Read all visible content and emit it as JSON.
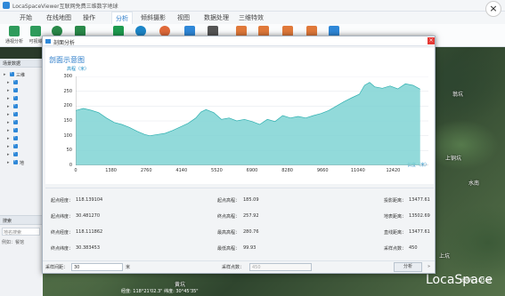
{
  "app": {
    "title": "LocaSpaceViewer互联网免费三维数字地球"
  },
  "menu": {
    "tabs": [
      "开始",
      "在线地图",
      "操作",
      "分析",
      "倾斜摄影",
      "视图",
      "数据处理",
      "三维特效"
    ]
  },
  "ribbon": {
    "buttons": [
      {
        "label": "通视分析",
        "icon": "line-of-sight-icon",
        "color": "#2e9b5b"
      },
      {
        "label": "可视域",
        "icon": "viewshed-icon",
        "color": "#2e9b5b"
      },
      {
        "label": "",
        "icon": "globe-icon",
        "color": "#2a8a4a"
      },
      {
        "label": "",
        "icon": "area-icon",
        "color": "#2a8a4a"
      },
      {
        "label": "",
        "icon": "square-icon",
        "color": "#1e9b4f"
      },
      {
        "label": "",
        "icon": "pie-icon",
        "color": "#1c86c8"
      },
      {
        "label": "",
        "icon": "sphere-icon",
        "color": "#e06a3a"
      },
      {
        "label": "",
        "icon": "brush-icon",
        "color": "#2f88d8"
      },
      {
        "label": "",
        "icon": "gear-icon",
        "color": "#555555"
      },
      {
        "label": "",
        "icon": "ruler-icon",
        "color": "#e0793a"
      },
      {
        "label": "",
        "icon": "distance-icon",
        "color": "#e0793a"
      },
      {
        "label": "",
        "icon": "measure-icon",
        "color": "#e0793a"
      },
      {
        "label": "",
        "icon": "area-m2-icon",
        "color": "#e0793a"
      },
      {
        "label": "",
        "icon": "edit-icon",
        "color": "#2f88d8"
      }
    ]
  },
  "left_panel": {
    "header": "场景数据",
    "tree": [
      {
        "text": "三维",
        "level": 0
      },
      {
        "text": "",
        "level": 1
      },
      {
        "text": "",
        "level": 1
      },
      {
        "text": "",
        "level": 1
      },
      {
        "text": "",
        "level": 1
      },
      {
        "text": "",
        "level": 1
      },
      {
        "text": "",
        "level": 1
      },
      {
        "text": "",
        "level": 1
      },
      {
        "text": "",
        "level": 1
      },
      {
        "text": "",
        "level": 1
      },
      {
        "text": "",
        "level": 1
      },
      {
        "text": "地",
        "level": 1
      }
    ],
    "search": {
      "header": "搜索",
      "placeholder": "地名搜索",
      "hint": "例如：餐馆"
    }
  },
  "map": {
    "labels": [
      "上铜坑",
      "水南",
      "黄坑",
      "上坑",
      "翁坑"
    ],
    "coords": "经度: 118°21'02.3\" 纬度: 30°45'35\"",
    "logo": "LocaSpace",
    "scale": "比例尺 1:2558"
  },
  "dialog": {
    "title": "剖面分析",
    "close": "×",
    "chart_title": "剖面示意图",
    "bottom": {
      "interval_label": "采样间距：",
      "interval_value": "30",
      "interval_unit": "米",
      "count_label": "采样点数：",
      "count_value": "450",
      "analyze_button": "分析",
      "collapse": "»"
    }
  },
  "info": [
    {
      "label": "起点经度：",
      "value": "118.139104"
    },
    {
      "label": "起点高程：",
      "value": "185.09"
    },
    {
      "label": "投影距离：",
      "value": "13477.61"
    },
    {
      "label": "起点纬度：",
      "value": "30.481270"
    },
    {
      "label": "终点高程：",
      "value": "257.92"
    },
    {
      "label": "地表距离：",
      "value": "13502.69"
    },
    {
      "label": "终点经度：",
      "value": "118.111862"
    },
    {
      "label": "最高高程：",
      "value": "280.76"
    },
    {
      "label": "直线距离：",
      "value": "13477.61"
    },
    {
      "label": "终点纬度：",
      "value": "30.383453"
    },
    {
      "label": "最低高程：",
      "value": "99.93"
    },
    {
      "label": "采样点数：",
      "value": "450"
    }
  ],
  "chart_data": {
    "type": "area",
    "title": "剖面示意图",
    "xlabel": "长度（米）",
    "ylabel": "高程（米）",
    "xlim": [
      0,
      13800
    ],
    "ylim": [
      0,
      300
    ],
    "xticks": [
      0,
      1380,
      2760,
      4140,
      5520,
      6900,
      8280,
      9660,
      11040,
      12420
    ],
    "yticks": [
      0,
      50,
      100,
      150,
      200,
      250,
      300
    ],
    "color": "#7fd3d3",
    "line_color": "#2fb0b0",
    "x": [
      0,
      300,
      600,
      900,
      1200,
      1500,
      1800,
      2100,
      2400,
      2700,
      2900,
      3200,
      3500,
      3800,
      4100,
      4400,
      4700,
      4900,
      5100,
      5400,
      5700,
      6000,
      6300,
      6600,
      6900,
      7200,
      7500,
      7800,
      8100,
      8400,
      8700,
      9000,
      9300,
      9600,
      9900,
      10200,
      10500,
      10800,
      11100,
      11300,
      11500,
      11700,
      12000,
      12300,
      12600,
      12900,
      13200,
      13477
    ],
    "y": [
      185,
      192,
      186,
      178,
      160,
      145,
      138,
      128,
      115,
      104,
      100,
      104,
      108,
      118,
      130,
      142,
      160,
      180,
      188,
      178,
      155,
      160,
      150,
      155,
      148,
      138,
      155,
      148,
      168,
      160,
      165,
      160,
      168,
      175,
      185,
      200,
      215,
      228,
      240,
      270,
      280,
      265,
      260,
      268,
      258,
      275,
      270,
      257
    ]
  }
}
